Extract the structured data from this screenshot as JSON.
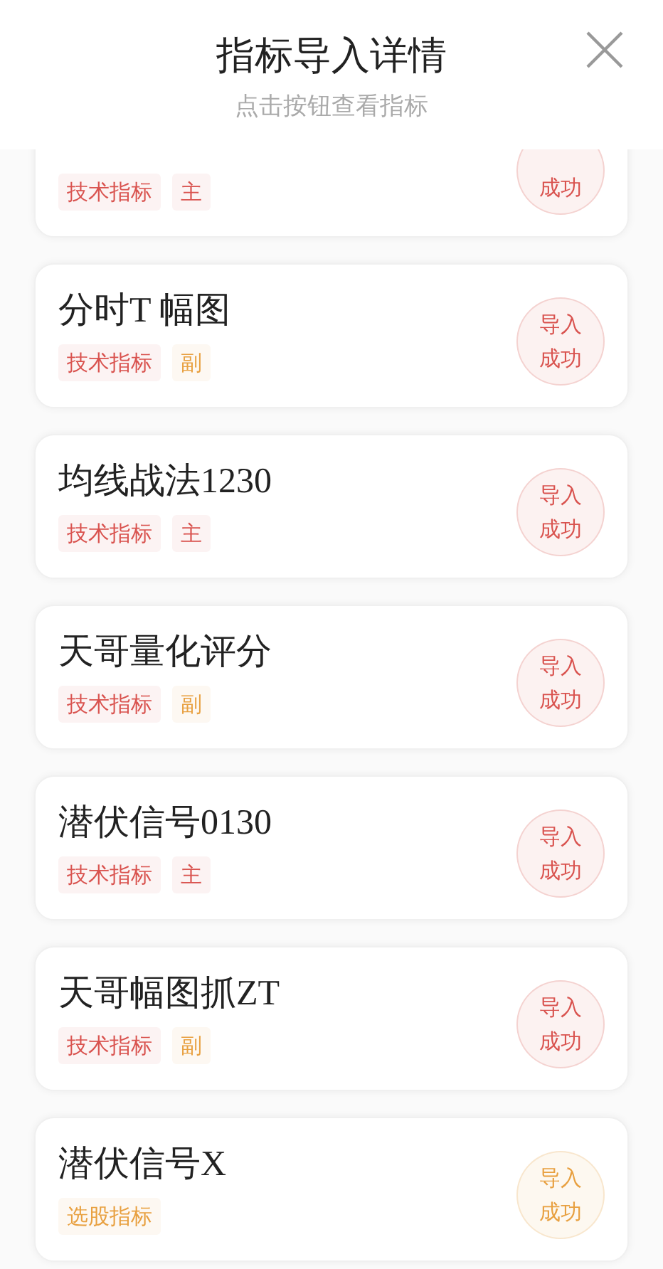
{
  "header": {
    "title": "指标导入详情",
    "subtitle": "点击按钮查看指标"
  },
  "items": [
    {
      "tags": [
        {
          "label": "技术指标",
          "color": "#d9534f"
        },
        {
          "label": "主",
          "color": "#d9534f"
        }
      ],
      "status": "成功",
      "color": "#d9534f"
    },
    {
      "title": "分时T 幅图",
      "tags": [
        {
          "label": "技术指标",
          "color": "#d9534f"
        },
        {
          "label": "副",
          "color": "#e8a040"
        }
      ],
      "status": "导入成功",
      "color": "#d9534f"
    },
    {
      "title": "均线战法1230",
      "tags": [
        {
          "label": "技术指标",
          "color": "#d9534f"
        },
        {
          "label": "主",
          "color": "#d9534f"
        }
      ],
      "status": "导入成功",
      "color": "#d9534f"
    },
    {
      "title": "天哥量化评分",
      "tags": [
        {
          "label": "技术指标",
          "color": "#d9534f"
        },
        {
          "label": "副",
          "color": "#e8a040"
        }
      ],
      "status": "导入成功",
      "color": "#d9534f"
    },
    {
      "title": "潜伏信号0130",
      "tags": [
        {
          "label": "技术指标",
          "color": "#d9534f"
        },
        {
          "label": "主",
          "color": "#d9534f"
        }
      ],
      "status": "导入成功",
      "color": "#d9534f"
    },
    {
      "title": "天哥幅图抓ZT",
      "tags": [
        {
          "label": "技术指标",
          "color": "#d9534f"
        },
        {
          "label": "副",
          "color": "#e8a040"
        }
      ],
      "status": "导入成功",
      "color": "#d9534f"
    },
    {
      "title": "潜伏信号X",
      "tags": [
        {
          "label": "选股指标",
          "color": "#e8a040"
        }
      ],
      "status": "导入成功",
      "color": "#e8a040"
    }
  ]
}
